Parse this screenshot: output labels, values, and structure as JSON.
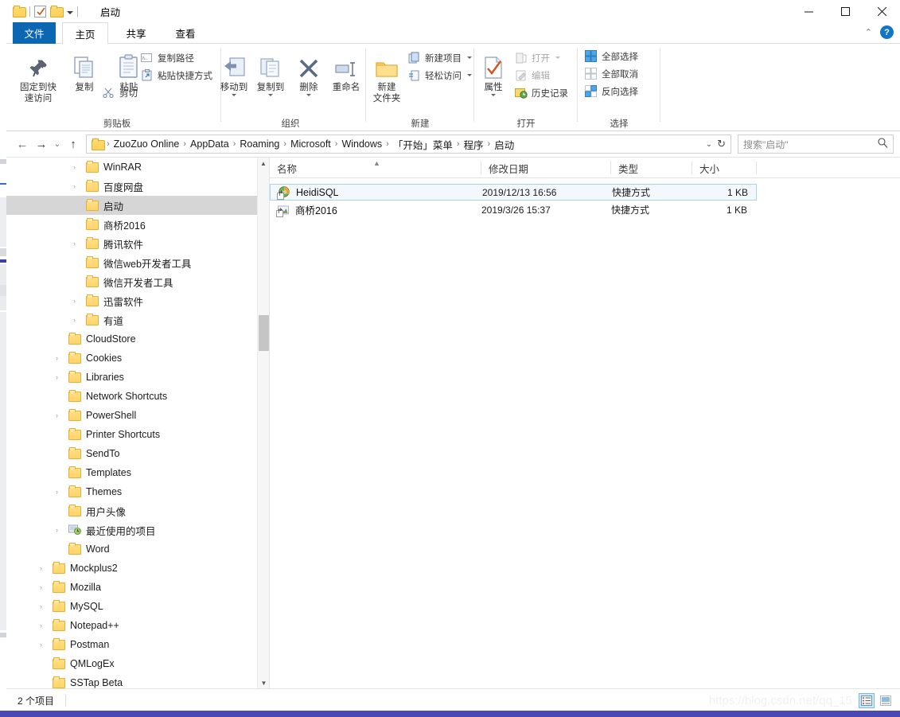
{
  "window": {
    "title": "启动",
    "quick_access": {
      "folder_icon": "folder-icon",
      "properties_icon": "properties-checkbox-icon",
      "new_folder_icon": "new-folder-icon",
      "customize_icon": "chevron-down-icon"
    },
    "controls": {
      "minimize": "—",
      "maximize": "□",
      "close": "✕",
      "collapse_ribbon": "⌃",
      "help": "?"
    }
  },
  "tabs": [
    {
      "label": "文件",
      "name": "tab-file"
    },
    {
      "label": "主页",
      "name": "tab-home"
    },
    {
      "label": "共享",
      "name": "tab-share"
    },
    {
      "label": "查看",
      "name": "tab-view"
    }
  ],
  "ribbon": {
    "groups": [
      {
        "label": "剪贴板",
        "big": [
          {
            "label": "固定到快\n速访问",
            "line1": "固定到快",
            "line2": "速访问",
            "icon": "pin-icon"
          },
          {
            "label": "复制",
            "icon": "copy-icon"
          },
          {
            "label": "粘贴",
            "icon": "paste-icon"
          }
        ],
        "small": [
          {
            "label": "复制路径",
            "icon": "copy-path-icon"
          },
          {
            "label": "粘贴快捷方式",
            "icon": "paste-shortcut-icon"
          },
          {
            "label": "剪切",
            "icon": "scissors-icon"
          }
        ]
      },
      {
        "label": "组织",
        "big": [
          {
            "label": "移动到",
            "icon": "move-to-icon",
            "caret": true
          },
          {
            "label": "复制到",
            "icon": "copy-to-icon",
            "caret": true
          },
          {
            "label": "删除",
            "icon": "delete-x-icon",
            "caret": true
          },
          {
            "label": "重命名",
            "icon": "rename-icon"
          }
        ]
      },
      {
        "label": "新建",
        "big": [
          {
            "line1": "新建",
            "line2": "文件夹",
            "label": "新建文件夹",
            "icon": "new-folder-icon"
          }
        ],
        "small": [
          {
            "label": "新建项目",
            "icon": "new-item-icon",
            "caret": true
          },
          {
            "label": "轻松访问",
            "icon": "easy-access-icon",
            "caret": true
          }
        ]
      },
      {
        "label": "打开",
        "big": [
          {
            "label": "属性",
            "icon": "properties-icon",
            "caret": true
          }
        ],
        "small": [
          {
            "label": "打开",
            "icon": "open-icon",
            "caret": true,
            "dim": true
          },
          {
            "label": "编辑",
            "icon": "edit-icon",
            "dim": true
          },
          {
            "label": "历史记录",
            "icon": "history-icon"
          }
        ]
      },
      {
        "label": "选择",
        "small": [
          {
            "label": "全部选择",
            "icon": "select-all-icon"
          },
          {
            "label": "全部取消",
            "icon": "select-none-icon"
          },
          {
            "label": "反向选择",
            "icon": "invert-selection-icon"
          }
        ]
      }
    ]
  },
  "address": {
    "back": "←",
    "forward": "→",
    "recent": "⌄",
    "up": "↑",
    "separator": "›",
    "crumbs": [
      "ZuoZuo Online",
      "AppData",
      "Roaming",
      "Microsoft",
      "Windows",
      "「开始」菜单",
      "程序",
      "启动"
    ],
    "dropdown": "⌄",
    "refresh": "↻"
  },
  "search": {
    "placeholder": "搜索\"启动\"",
    "icon": "search-icon"
  },
  "nav_tree": [
    {
      "label": "WinRAR",
      "indent": 2,
      "icon": "folder-icon",
      "expandable": true
    },
    {
      "label": "百度网盘",
      "indent": 2,
      "icon": "folder-icon",
      "expandable": true
    },
    {
      "label": "启动",
      "indent": 2,
      "icon": "folder-icon",
      "selected": true,
      "expandable": false
    },
    {
      "label": "商桥2016",
      "indent": 2,
      "icon": "folder-icon",
      "expandable": false
    },
    {
      "label": "腾讯软件",
      "indent": 2,
      "icon": "folder-icon",
      "expandable": true
    },
    {
      "label": "微信web开发者工具",
      "indent": 2,
      "icon": "folder-icon",
      "expandable": false
    },
    {
      "label": "微信开发者工具",
      "indent": 2,
      "icon": "folder-icon",
      "expandable": false
    },
    {
      "label": "迅雷软件",
      "indent": 2,
      "icon": "folder-icon",
      "expandable": true
    },
    {
      "label": "有道",
      "indent": 2,
      "icon": "folder-icon",
      "expandable": true
    },
    {
      "label": "CloudStore",
      "indent": 1,
      "icon": "folder-icon",
      "expandable": false
    },
    {
      "label": "Cookies",
      "indent": 1,
      "icon": "folder-icon",
      "expandable": true
    },
    {
      "label": "Libraries",
      "indent": 1,
      "icon": "folder-icon",
      "expandable": true
    },
    {
      "label": "Network Shortcuts",
      "indent": 1,
      "icon": "folder-icon",
      "expandable": false
    },
    {
      "label": "PowerShell",
      "indent": 1,
      "icon": "folder-icon",
      "expandable": true
    },
    {
      "label": "Printer Shortcuts",
      "indent": 1,
      "icon": "folder-icon",
      "expandable": false
    },
    {
      "label": "SendTo",
      "indent": 1,
      "icon": "folder-icon",
      "expandable": false
    },
    {
      "label": "Templates",
      "indent": 1,
      "icon": "folder-icon",
      "expandable": false
    },
    {
      "label": "Themes",
      "indent": 1,
      "icon": "folder-icon",
      "expandable": true
    },
    {
      "label": "用户头像",
      "indent": 1,
      "icon": "folder-icon",
      "expandable": false
    },
    {
      "label": "最近使用的项目",
      "indent": 1,
      "icon": "recent-items-icon",
      "expandable": true
    },
    {
      "label": "Word",
      "indent": 1,
      "icon": "folder-icon",
      "expandable": false
    },
    {
      "label": "Mockplus2",
      "indent": 0,
      "icon": "folder-icon",
      "expandable": true
    },
    {
      "label": "Mozilla",
      "indent": 0,
      "icon": "folder-icon",
      "expandable": true
    },
    {
      "label": "MySQL",
      "indent": 0,
      "icon": "folder-icon",
      "expandable": true
    },
    {
      "label": "Notepad++",
      "indent": 0,
      "icon": "folder-icon",
      "expandable": true
    },
    {
      "label": "Postman",
      "indent": 0,
      "icon": "folder-icon",
      "expandable": true
    },
    {
      "label": "QMLogEx",
      "indent": 0,
      "icon": "folder-icon",
      "expandable": false
    },
    {
      "label": "SSTap Beta",
      "indent": 0,
      "icon": "folder-icon",
      "expandable": false
    }
  ],
  "file_list": {
    "columns": [
      {
        "label": "名称",
        "key": "name",
        "sorted": true,
        "sort_dir": "asc"
      },
      {
        "label": "修改日期",
        "key": "date"
      },
      {
        "label": "类型",
        "key": "type"
      },
      {
        "label": "大小",
        "key": "size"
      }
    ],
    "rows": [
      {
        "name": "HeidiSQL",
        "date": "2019/12/13 16:56",
        "type": "快捷方式",
        "size": "1 KB",
        "icon": "heidisql-shortcut-icon",
        "selected": true
      },
      {
        "name": "商桥2016",
        "date": "2019/3/26 15:37",
        "type": "快捷方式",
        "size": "1 KB",
        "icon": "shangqiao-shortcut-icon",
        "selected": false
      }
    ]
  },
  "status": {
    "item_count": "2 个项目",
    "watermark": "https://blog.csdn.net/qq_15",
    "view_details_icon": "details-view-icon",
    "view_large_icon": "large-icons-view-icon"
  },
  "colors": {
    "accent": "#0b67b2",
    "selection_row": "#f2f8fd",
    "selection_border": "#a8d3f0",
    "nav_selection": "#d6d6d6",
    "folder_yellow": "#fdd465",
    "taskbar": "#4a48b5"
  }
}
